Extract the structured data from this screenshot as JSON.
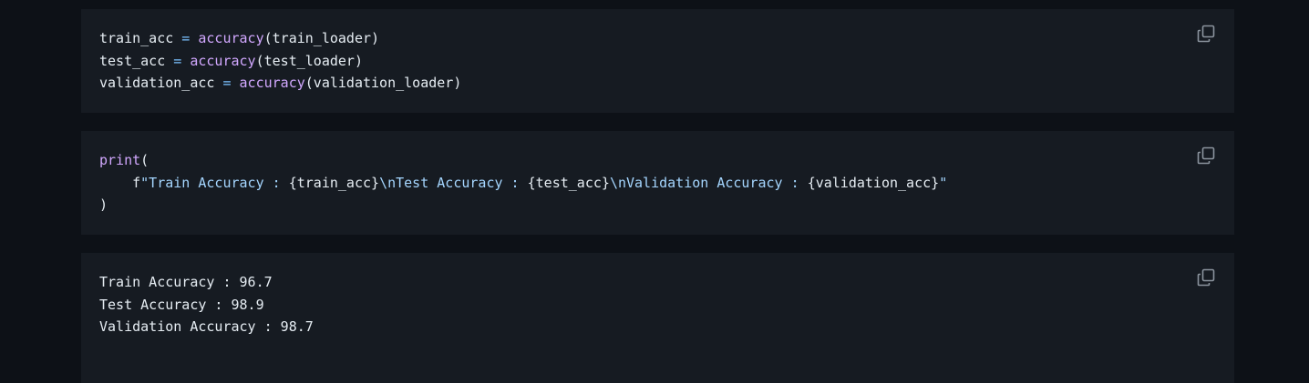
{
  "blocks": [
    {
      "lines": [
        [
          {
            "t": "train_acc",
            "c": "id"
          },
          {
            "t": " = ",
            "c": "op"
          },
          {
            "t": "accuracy",
            "c": "fn"
          },
          {
            "t": "(train_loader)",
            "c": "id"
          }
        ],
        [
          {
            "t": "test_acc",
            "c": "id"
          },
          {
            "t": " = ",
            "c": "op"
          },
          {
            "t": "accuracy",
            "c": "fn"
          },
          {
            "t": "(test_loader)",
            "c": "id"
          }
        ],
        [
          {
            "t": "validation_acc",
            "c": "id"
          },
          {
            "t": " = ",
            "c": "op"
          },
          {
            "t": "accuracy",
            "c": "fn"
          },
          {
            "t": "(validation_loader)",
            "c": "id"
          }
        ]
      ]
    },
    {
      "lines": [
        [
          {
            "t": "print",
            "c": "fn"
          },
          {
            "t": "(",
            "c": "id"
          }
        ],
        [
          {
            "t": "    f",
            "c": "id"
          },
          {
            "t": "\"Train Accuracy : ",
            "c": "str"
          },
          {
            "t": "{train_acc}",
            "c": "id"
          },
          {
            "t": "\\nTest Accuracy : ",
            "c": "str"
          },
          {
            "t": "{test_acc}",
            "c": "id"
          },
          {
            "t": "\\nValidation Accuracy : ",
            "c": "str"
          },
          {
            "t": "{validation_acc}",
            "c": "id"
          },
          {
            "t": "\"",
            "c": "str"
          }
        ],
        [
          {
            "t": ")",
            "c": "id"
          }
        ]
      ]
    },
    {
      "lines": [
        [
          {
            "t": "Train Accuracy : 96.7",
            "c": "id"
          }
        ],
        [
          {
            "t": "Test Accuracy : 98.9",
            "c": "id"
          }
        ],
        [
          {
            "t": "Validation Accuracy : 98.7",
            "c": "id"
          }
        ]
      ]
    }
  ],
  "icons": {
    "copy": "copy-icon"
  },
  "colors": {
    "page_bg": "#0d1117",
    "block_bg": "#161b22",
    "text": "#e6edf3",
    "function": "#d2a8ff",
    "string": "#a5d6ff",
    "operator": "#79c0ff",
    "icon": "#8b949e"
  }
}
